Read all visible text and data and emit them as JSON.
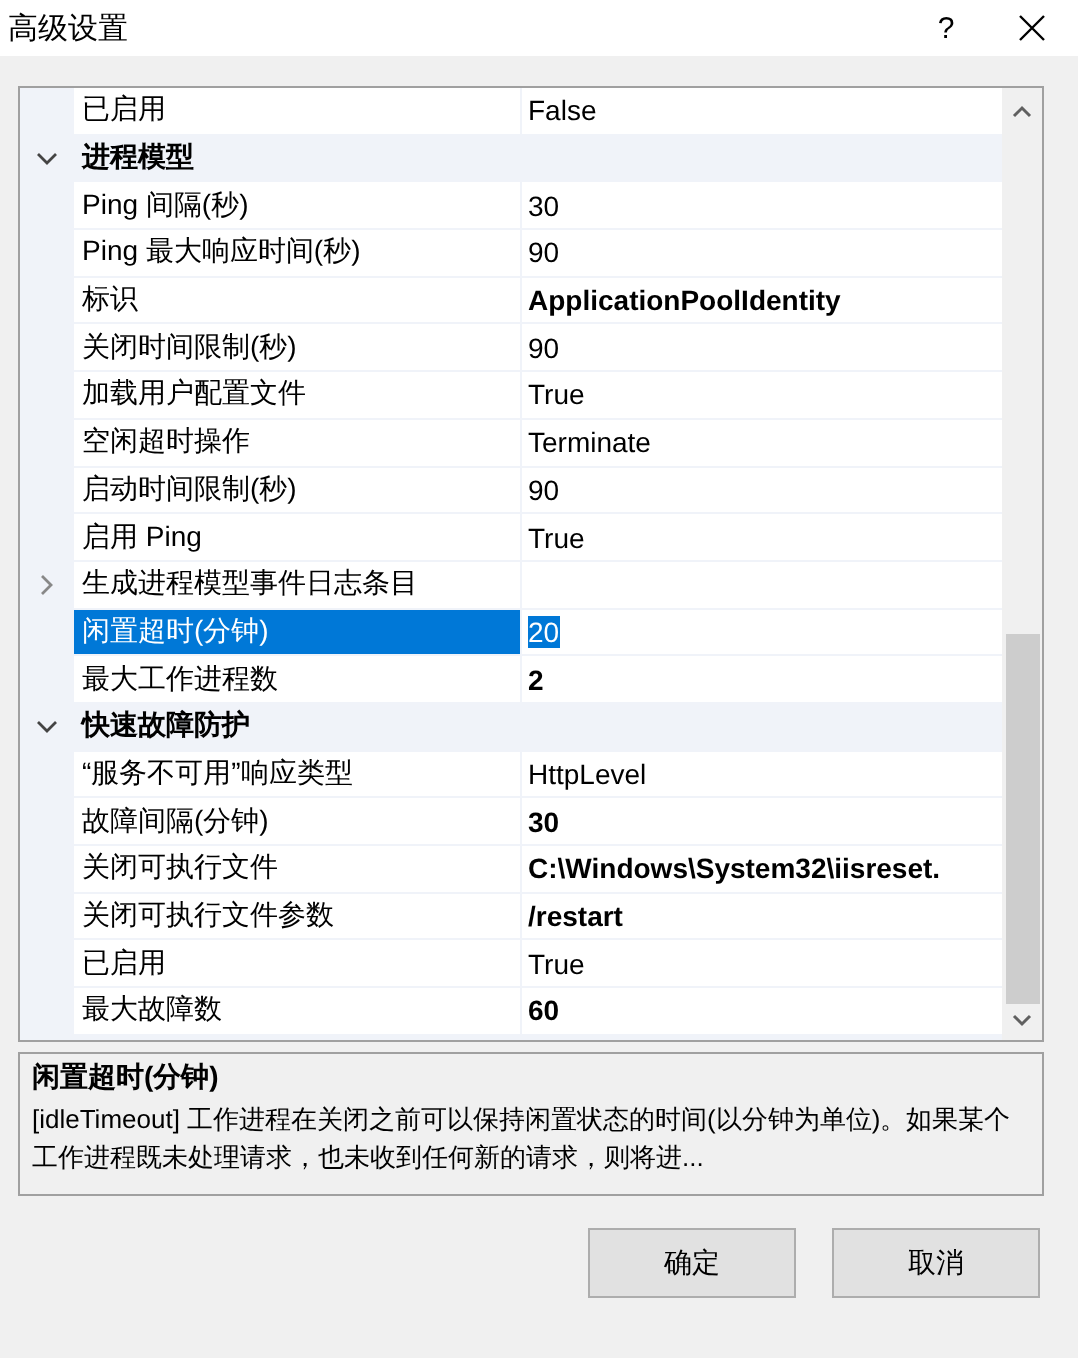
{
  "window": {
    "title": "高级设置",
    "help": "?"
  },
  "grid": {
    "rows": [
      {
        "kind": "property",
        "name": "已启用",
        "value": "False",
        "bold": false,
        "selected": false
      },
      {
        "kind": "category",
        "name": "进程模型",
        "expanded": true
      },
      {
        "kind": "property",
        "name": "Ping 间隔(秒)",
        "value": "30",
        "bold": false,
        "selected": false
      },
      {
        "kind": "property",
        "name": "Ping 最大响应时间(秒)",
        "value": "90",
        "bold": false,
        "selected": false
      },
      {
        "kind": "property",
        "name": "标识",
        "value": "ApplicationPoolIdentity",
        "bold": true,
        "selected": false
      },
      {
        "kind": "property",
        "name": "关闭时间限制(秒)",
        "value": "90",
        "bold": false,
        "selected": false
      },
      {
        "kind": "property",
        "name": "加载用户配置文件",
        "value": "True",
        "bold": false,
        "selected": false
      },
      {
        "kind": "property",
        "name": "空闲超时操作",
        "value": "Terminate",
        "bold": false,
        "selected": false
      },
      {
        "kind": "property",
        "name": "启动时间限制(秒)",
        "value": "90",
        "bold": false,
        "selected": false
      },
      {
        "kind": "property",
        "name": "启用 Ping",
        "value": "True",
        "bold": false,
        "selected": false
      },
      {
        "kind": "group",
        "name": "生成进程模型事件日志条目",
        "expanded": false
      },
      {
        "kind": "property",
        "name": "闲置超时(分钟)",
        "value": "20",
        "bold": false,
        "selected": true
      },
      {
        "kind": "property",
        "name": "最大工作进程数",
        "value": "2",
        "bold": true,
        "selected": false
      },
      {
        "kind": "category",
        "name": "快速故障防护",
        "expanded": true
      },
      {
        "kind": "property",
        "name": "“服务不可用”响应类型",
        "value": "HttpLevel",
        "bold": false,
        "selected": false
      },
      {
        "kind": "property",
        "name": "故障间隔(分钟)",
        "value": "30",
        "bold": true,
        "selected": false
      },
      {
        "kind": "property",
        "name": "关闭可执行文件",
        "value": "C:\\Windows\\System32\\iisreset.",
        "bold": true,
        "selected": false
      },
      {
        "kind": "property",
        "name": "关闭可执行文件参数",
        "value": "/restart",
        "bold": true,
        "selected": false
      },
      {
        "kind": "property",
        "name": "已启用",
        "value": "True",
        "bold": false,
        "selected": false
      },
      {
        "kind": "property",
        "name": "最大故障数",
        "value": "60",
        "bold": true,
        "selected": false
      }
    ]
  },
  "description": {
    "title": "闲置超时(分钟)",
    "text": "[idleTimeout] 工作进程在关闭之前可以保持闲置状态的时间(以分钟为单位)。如果某个工作进程既未处理请求，也未收到任何新的请求，则将进..."
  },
  "buttons": [
    "确定",
    "取消"
  ]
}
